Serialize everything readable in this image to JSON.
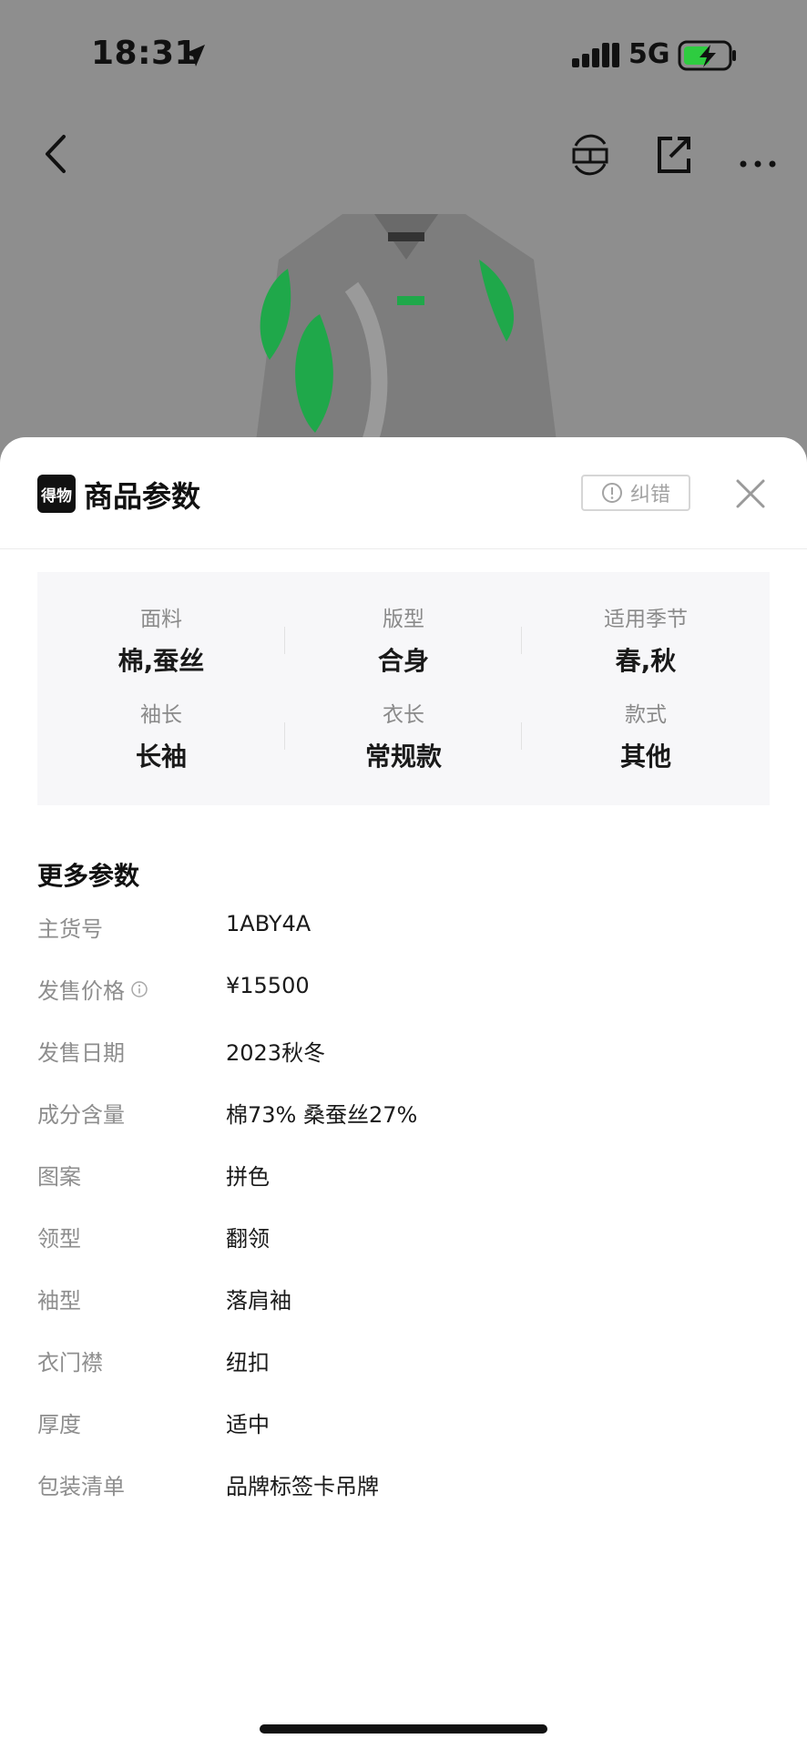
{
  "status_bar": {
    "time": "18:31",
    "network": "5G"
  },
  "sheet": {
    "logo_text": "得物",
    "title": "商品参数",
    "report_label": "纠错",
    "params": [
      {
        "label": "面料",
        "value": "棉,蚕丝"
      },
      {
        "label": "版型",
        "value": "合身"
      },
      {
        "label": "适用季节",
        "value": "春,秋"
      },
      {
        "label": "袖长",
        "value": "长袖"
      },
      {
        "label": "衣长",
        "value": "常规款"
      },
      {
        "label": "款式",
        "value": "其他"
      }
    ],
    "more_title": "更多参数",
    "details": [
      {
        "label": "主货号",
        "value": "1ABY4A"
      },
      {
        "label": "发售价格",
        "value": "¥15500",
        "info": true
      },
      {
        "label": "发售日期",
        "value": "2023秋冬"
      },
      {
        "label": "成分含量",
        "value": "棉73% 桑蚕丝27%"
      },
      {
        "label": "图案",
        "value": "拼色"
      },
      {
        "label": "领型",
        "value": "翻领"
      },
      {
        "label": "袖型",
        "value": "落肩袖"
      },
      {
        "label": "衣门襟",
        "value": "纽扣"
      },
      {
        "label": "厚度",
        "value": "适中"
      },
      {
        "label": "包装清单",
        "value": "品牌标签卡吊牌"
      }
    ]
  },
  "colors": {
    "accent_green": "#1fa84a",
    "backdrop": "#8e8e8e"
  },
  "icons": [
    "location-arrow-icon",
    "signal-icon",
    "battery-icon",
    "back-icon",
    "sell-icon",
    "share-icon",
    "more-icon",
    "info-circle-icon",
    "close-icon"
  ]
}
